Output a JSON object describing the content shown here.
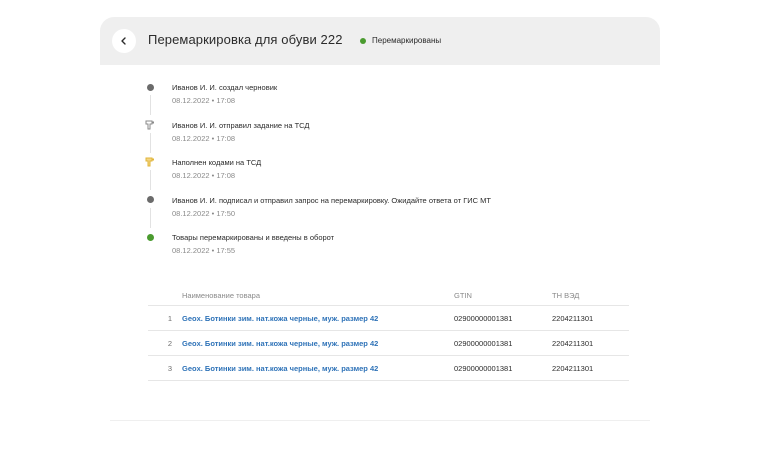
{
  "header": {
    "title": "Перемаркировка для обуви 222",
    "status_label": "Перемаркированы",
    "status_color": "#4a9b2f",
    "back_icon": "chevron-left-icon"
  },
  "timeline": [
    {
      "text": "Иванов И. И. создал черновик",
      "time": "08.12.2022 • 17:08",
      "marker": "dot",
      "color": "#6b6b6b"
    },
    {
      "text": "Иванов И. И. отправил задание на ТСД",
      "time": "08.12.2022 • 17:08",
      "marker": "scanner-icon",
      "color": "#8a8a8a"
    },
    {
      "text": "Наполнен кодами на ТСД",
      "time": "08.12.2022 • 17:08",
      "marker": "scanner-icon",
      "color": "#e0b53a"
    },
    {
      "text": "Иванов И. И. подписал и отправил запрос на перемаркировку. Ожидайте ответа от ГИС МТ",
      "time": "08.12.2022 • 17:50",
      "marker": "dot",
      "color": "#6b6b6b"
    },
    {
      "text": "Товары перемаркированы и введены в оборот",
      "time": "08.12.2022 • 17:55",
      "marker": "dot",
      "color": "#4a9b2f"
    }
  ],
  "table": {
    "columns": {
      "name": "Наименование товара",
      "gtin": "GTIN",
      "tn": "ТН ВЭД"
    },
    "rows": [
      {
        "num": "1",
        "name": "Geox. Ботинки зим. нат.кожа черные, муж. размер 42",
        "gtin": "02900000001381",
        "tn": "2204211301"
      },
      {
        "num": "2",
        "name": "Geox. Ботинки зим. нат.кожа черные, муж. размер 42",
        "gtin": "02900000001381",
        "tn": "2204211301"
      },
      {
        "num": "3",
        "name": "Geox. Ботинки зим. нат.кожа черные, муж. размер 42",
        "gtin": "02900000001381",
        "tn": "2204211301"
      }
    ]
  }
}
